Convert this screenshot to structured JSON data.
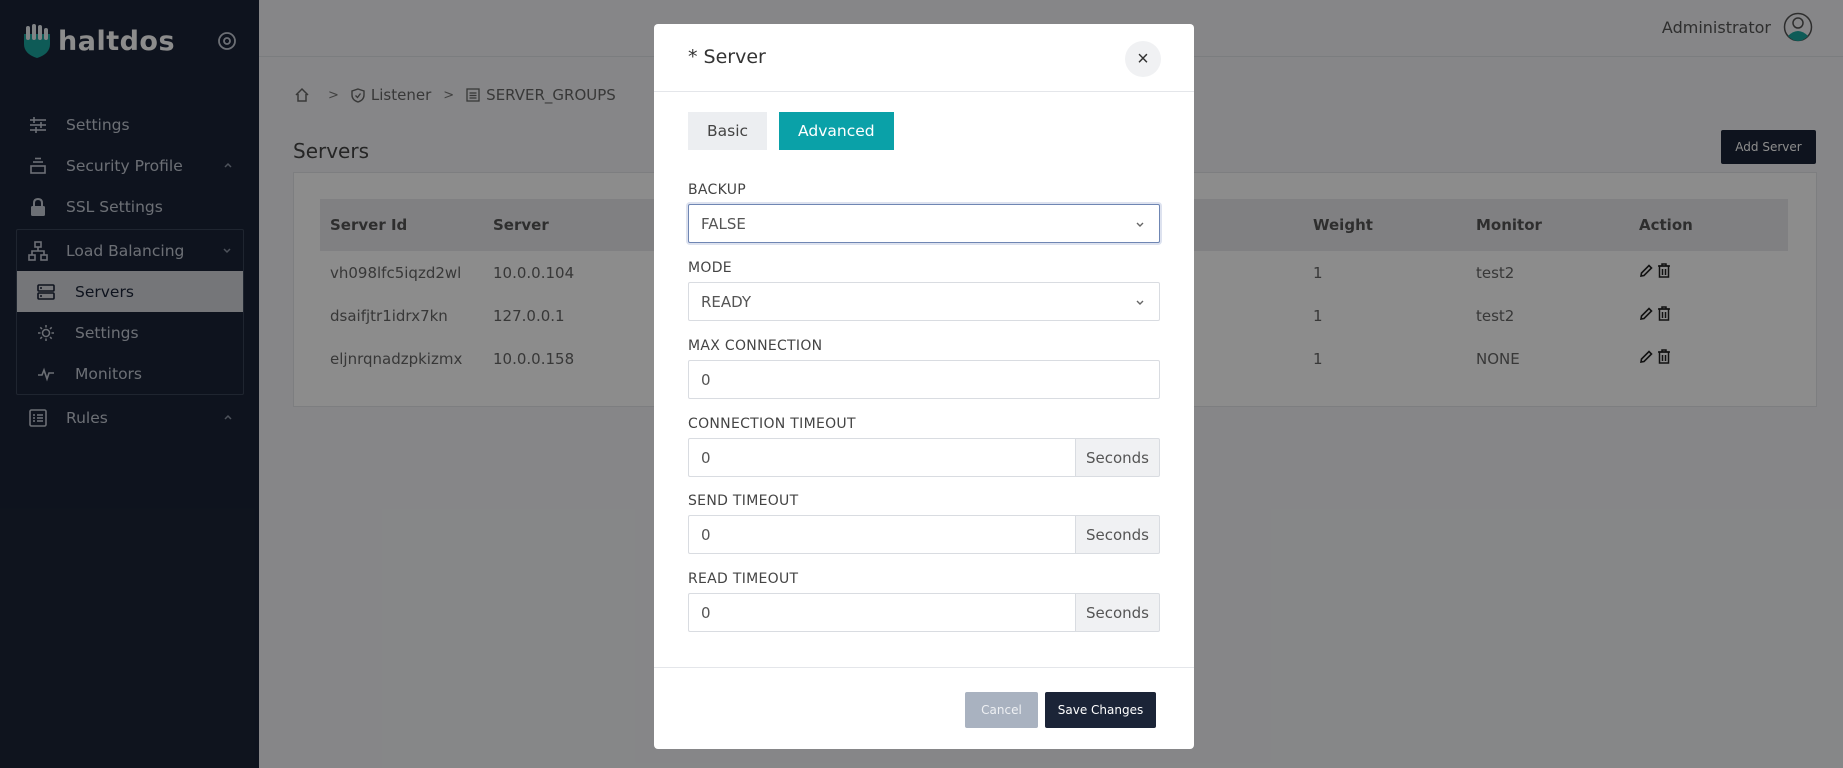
{
  "sidebar": {
    "brand": "haltdos",
    "items": [
      {
        "label": "Settings",
        "icon": "sliders-icon"
      },
      {
        "label": "Security Profile",
        "icon": "layers-icon"
      },
      {
        "label": "SSL Settings",
        "icon": "lock-icon"
      },
      {
        "label": "Load Balancing",
        "icon": "network-icon"
      },
      {
        "label": "Rules",
        "icon": "list-icon"
      }
    ],
    "sub_items": [
      {
        "label": "Servers",
        "icon": "server-icon",
        "active": true
      },
      {
        "label": "Settings",
        "icon": "gear-icon"
      },
      {
        "label": "Monitors",
        "icon": "pulse-icon"
      }
    ]
  },
  "topbar": {
    "user": "Administrator"
  },
  "breadcrumb": {
    "home": "",
    "listener": "Listener",
    "group": "SERVER_GROUPS"
  },
  "page": {
    "title": "Servers",
    "add_button": "Add Server",
    "table": {
      "headers": [
        "Server Id",
        "Server",
        "Weight",
        "Monitor",
        "Action"
      ],
      "rows": [
        {
          "id": "vh098lfc5iqzd2wl",
          "server": "10.0.0.104",
          "weight": "1",
          "monitor": "test2"
        },
        {
          "id": "dsaifjtr1idrx7kn",
          "server": "127.0.0.1",
          "weight": "1",
          "monitor": "test2"
        },
        {
          "id": "eljnrqnadzpkizmx",
          "server": "10.0.0.158",
          "weight": "1",
          "monitor": "NONE"
        }
      ]
    }
  },
  "modal": {
    "title": "* Server",
    "close": "×",
    "tabs": {
      "basic": "Basic",
      "advanced": "Advanced"
    },
    "fields": {
      "backup": {
        "label": "BACKUP",
        "value": "FALSE"
      },
      "mode": {
        "label": "MODE",
        "value": "READY"
      },
      "max_connection": {
        "label": "MAX CONNECTION",
        "value": "0"
      },
      "connection_timeout": {
        "label": "CONNECTION TIMEOUT",
        "value": "0",
        "unit": "Seconds"
      },
      "send_timeout": {
        "label": "SEND TIMEOUT",
        "value": "0",
        "unit": "Seconds"
      },
      "read_timeout": {
        "label": "READ TIMEOUT",
        "value": "0",
        "unit": "Seconds"
      }
    },
    "footer": {
      "cancel": "Cancel",
      "save": "Save Changes"
    }
  },
  "colors": {
    "sidebar": "#1b2437",
    "accent": "#0aa1a8"
  }
}
